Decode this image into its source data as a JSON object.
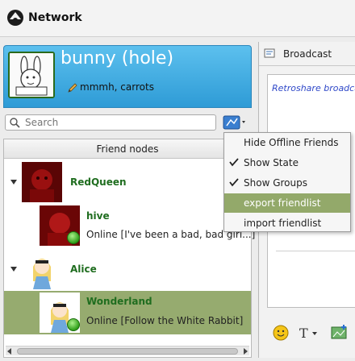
{
  "window": {
    "title": "Network"
  },
  "profile": {
    "name": "bunny (hole)",
    "status": "mmmh, carrots"
  },
  "search": {
    "placeholder": "Search"
  },
  "friends": {
    "header": "Friend nodes",
    "nodes": [
      {
        "name": "RedQueen"
      },
      {
        "name": "hive",
        "status": "Online [I've been a bad, bad girl...]"
      },
      {
        "name": "Alice"
      },
      {
        "name": "Wonderland",
        "status": "Online [Follow the White Rabbit]"
      }
    ]
  },
  "broadcast": {
    "tab_label": "Broadcast",
    "message": "Retroshare broadcast"
  },
  "menu": {
    "items": [
      {
        "label": "Hide Offline Friends",
        "checked": false
      },
      {
        "label": "Show State",
        "checked": true
      },
      {
        "label": "Show Groups",
        "checked": true
      },
      {
        "label": "export friendlist",
        "checked": false,
        "highlighted": true
      },
      {
        "label": "import friendlist",
        "checked": false
      }
    ]
  },
  "colors": {
    "accent": "#2e9bd6",
    "selection": "#96ab6f",
    "friend_name": "#1f6d1f"
  }
}
